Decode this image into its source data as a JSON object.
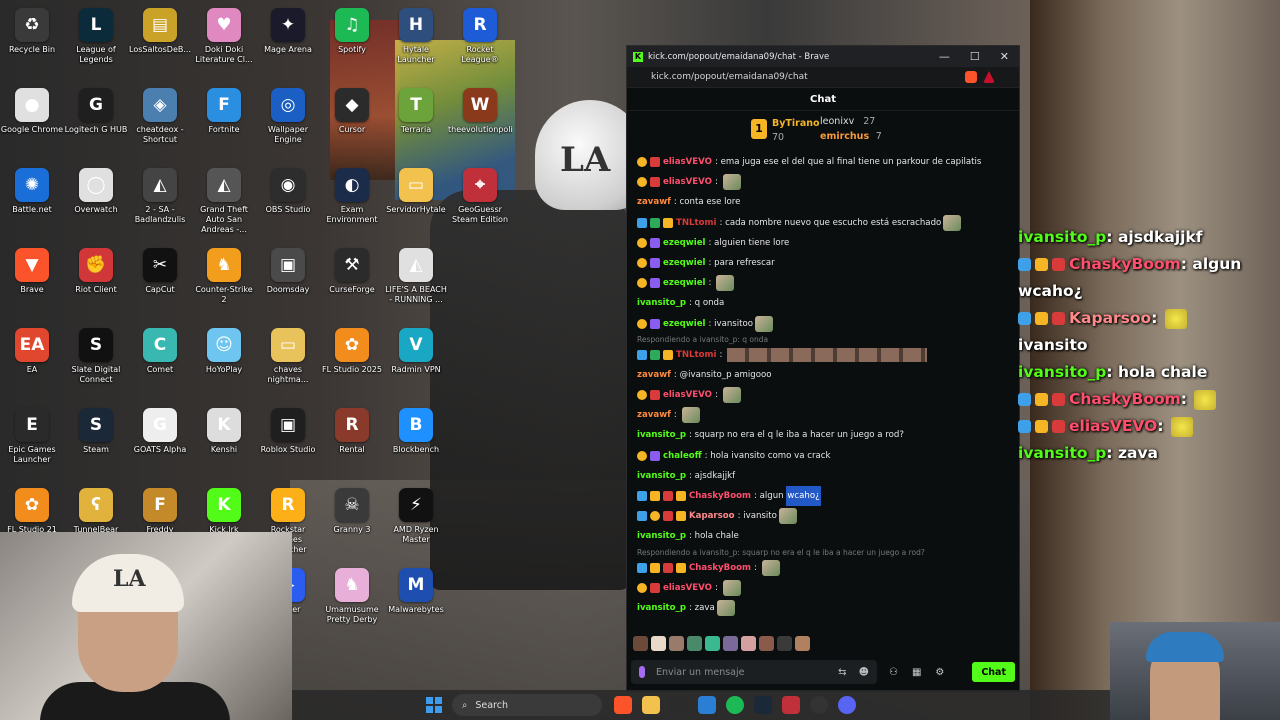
{
  "desktop_icons": [
    {
      "label": "Recycle Bin",
      "color": "#3a3a3a",
      "glyph": "♻"
    },
    {
      "label": "League of Legends",
      "color": "#0b2a3a",
      "glyph": "L"
    },
    {
      "label": "LosSaltosDeB...",
      "color": "#c9a227",
      "glyph": "▤"
    },
    {
      "label": "Doki Doki Literature Cl...",
      "color": "#e089c0",
      "glyph": "♥"
    },
    {
      "label": "Mage Arena",
      "color": "#1a1a2a",
      "glyph": "✦"
    },
    {
      "label": "Spotify",
      "color": "#1db954",
      "glyph": "♫"
    },
    {
      "label": "Hytale Launcher",
      "color": "#2e4e7e",
      "glyph": "H"
    },
    {
      "label": "Rocket League®",
      "color": "#1e5bd6",
      "glyph": "R"
    },
    {
      "label": "Google Chrome",
      "color": "#e0e0e0",
      "glyph": "●"
    },
    {
      "label": "Logitech G HUB",
      "color": "#1f1f1f",
      "glyph": "G"
    },
    {
      "label": "cheatdeox - Shortcut",
      "color": "#4a7fb0",
      "glyph": "◈"
    },
    {
      "label": "Fortnite",
      "color": "#2a8fe0",
      "glyph": "F"
    },
    {
      "label": "Wallpaper Engine",
      "color": "#1b5ec4",
      "glyph": "◎"
    },
    {
      "label": "Cursor",
      "color": "#2b2b2b",
      "glyph": "◆"
    },
    {
      "label": "Terraria",
      "color": "#6ca33a",
      "glyph": "T"
    },
    {
      "label": "theevolutionpoli...",
      "color": "#8a3a1a",
      "glyph": "W"
    },
    {
      "label": "Battle.net",
      "color": "#1a6ed8",
      "glyph": "✺"
    },
    {
      "label": "Overwatch",
      "color": "#e0e0e0",
      "glyph": "◯"
    },
    {
      "label": "2 - SA - Badlandzulis",
      "color": "#444",
      "glyph": "◭"
    },
    {
      "label": "Grand Theft Auto San Andreas -...",
      "color": "#555",
      "glyph": "◭"
    },
    {
      "label": "OBS Studio",
      "color": "#2d2d2d",
      "glyph": "◉"
    },
    {
      "label": "Exam Environment",
      "color": "#1b2b4a",
      "glyph": "◐"
    },
    {
      "label": "ServidorHytale",
      "color": "#f2c14e",
      "glyph": "▭"
    },
    {
      "label": "GeoGuessr Steam Edition",
      "color": "#c0303a",
      "glyph": "⌖"
    },
    {
      "label": "Brave",
      "color": "#fb542b",
      "glyph": "▼"
    },
    {
      "label": "Riot Client",
      "color": "#d13639",
      "glyph": "✊"
    },
    {
      "label": "CapCut",
      "color": "#111",
      "glyph": "✂"
    },
    {
      "label": "Counter-Strike 2",
      "color": "#f29d1c",
      "glyph": "♞"
    },
    {
      "label": "Doomsday",
      "color": "#4a4a4a",
      "glyph": "▣"
    },
    {
      "label": "CurseForge",
      "color": "#2b2b2b",
      "glyph": "⚒"
    },
    {
      "label": "LIFE'S A BEACH - RUNNING ...",
      "color": "#e0e0e0",
      "glyph": "◭"
    },
    {
      "label": "EA",
      "color": "#e0472e",
      "glyph": "EA"
    },
    {
      "label": "Slate Digital Connect",
      "color": "#111",
      "glyph": "S"
    },
    {
      "label": "Comet",
      "color": "#38b8b0",
      "glyph": "C"
    },
    {
      "label": "HoYoPlay",
      "color": "#6ec6f0",
      "glyph": "☺"
    },
    {
      "label": "chaves nightma...",
      "color": "#e8c25a",
      "glyph": "▭"
    },
    {
      "label": "FL Studio 2025",
      "color": "#f28c1c",
      "glyph": "✿"
    },
    {
      "label": "Radmin VPN",
      "color": "#1aa7c4",
      "glyph": "V"
    },
    {
      "label": "Epic Games Launcher",
      "color": "#2a2a2a",
      "glyph": "E"
    },
    {
      "label": "Steam",
      "color": "#1b2838",
      "glyph": "S"
    },
    {
      "label": "GOATS Alpha",
      "color": "#eee",
      "glyph": "G"
    },
    {
      "label": "Kenshi",
      "color": "#ddd",
      "glyph": "K"
    },
    {
      "label": "Roblox Studio",
      "color": "#1f1f1f",
      "glyph": "▣"
    },
    {
      "label": "Rental",
      "color": "#8a3a2a",
      "glyph": "R"
    },
    {
      "label": "Blockbench",
      "color": "#1e90ff",
      "glyph": "B"
    },
    {
      "label": "FL Studio 21",
      "color": "#f28c1c",
      "glyph": "✿"
    },
    {
      "label": "TunnelBear",
      "color": "#e2b33c",
      "glyph": "ʕ"
    },
    {
      "label": "Freddy Fazbear's",
      "color": "#c48a2a",
      "glyph": "F"
    },
    {
      "label": "Kick.lrk",
      "color": "#53fc18",
      "glyph": "K"
    },
    {
      "label": "Rockstar Games Launcher",
      "color": "#fcaf17",
      "glyph": "R"
    },
    {
      "label": "Granny 3",
      "color": "#3a3a3a",
      "glyph": "☠"
    },
    {
      "label": "AMD Ryzen Master",
      "color": "#111",
      "glyph": "⚡"
    },
    {
      "label": "Player",
      "color": "#2a5cf0",
      "glyph": "▶"
    },
    {
      "label": "Umamusume Pretty Derby",
      "color": "#e8b0d8",
      "glyph": "♞"
    },
    {
      "label": "Malwarebytes",
      "color": "#1d4eb0",
      "glyph": "M"
    }
  ],
  "browser": {
    "window_title": "kick.com/popout/emaidana09/chat - Brave",
    "url": "kick.com/popout/emaidana09/chat",
    "min": "—",
    "max": "☐",
    "close": "✕",
    "favicon": "K"
  },
  "chat": {
    "header": "Chat",
    "top_gifters": {
      "first_name": "ByTirano",
      "first_count": "70",
      "second_name": "leonixv",
      "second_count": "27",
      "third_name": "emirchus",
      "third_count": "7",
      "rank_glyph": "1"
    },
    "messages": [
      {
        "user": "eliasVEVO",
        "color": "#ff4f6d",
        "badges": [
          "sub",
          "red"
        ],
        "text": "ema juga ese el del que al final tiene un parkour de capilatis"
      },
      {
        "user": "eliasVEVO",
        "color": "#ff4f6d",
        "badges": [
          "sub",
          "red"
        ],
        "text": "",
        "emote": true
      },
      {
        "user": "zavawf",
        "color": "#ff8a3d",
        "badges": [],
        "text": "conta ese lore"
      },
      {
        "user": "TNLtomi",
        "color": "#d93a3a",
        "badges": [
          "mod",
          "green",
          "og"
        ],
        "text": "cada nombre nuevo que escucho está escrachado",
        "emote": true
      },
      {
        "user": "ezeqwiel",
        "color": "#53fc18",
        "badges": [
          "sub",
          "purple"
        ],
        "text": "alguien tiene lore"
      },
      {
        "user": "ezeqwiel",
        "color": "#53fc18",
        "badges": [
          "sub",
          "purple"
        ],
        "text": "para refrescar"
      },
      {
        "user": "ezeqwiel",
        "color": "#53fc18",
        "badges": [
          "sub",
          "purple"
        ],
        "text": "",
        "emote": true
      },
      {
        "user": "ivansito_p",
        "color": "#53fc18",
        "badges": [],
        "text": "q onda"
      },
      {
        "user": "ezeqwiel",
        "color": "#53fc18",
        "badges": [
          "sub",
          "purple"
        ],
        "text": "ivansitoo",
        "emote": true
      },
      {
        "reply": "Respondiendo a ivansito_p: q onda"
      },
      {
        "user": "TNLtomi",
        "color": "#d93a3a",
        "badges": [
          "mod",
          "green",
          "og"
        ],
        "text": "",
        "strip": true
      },
      {
        "user": "zavawf",
        "color": "#ff8a3d",
        "badges": [],
        "text": "@ivansito_p amigooo"
      },
      {
        "user": "eliasVEVO",
        "color": "#ff4f6d",
        "badges": [
          "sub",
          "red"
        ],
        "text": "",
        "emote": true
      },
      {
        "user": "zavawf",
        "color": "#ff8a3d",
        "badges": [],
        "text": "",
        "emote": true
      },
      {
        "user": "ivansito_p",
        "color": "#53fc18",
        "badges": [],
        "text": "squarp no era el q le iba a hacer un juego a rod?"
      },
      {
        "user": "chaleoff",
        "color": "#53fc18",
        "badges": [
          "sub",
          "purple"
        ],
        "text": "hola ivansito como va crack"
      },
      {
        "user": "ivansito_p",
        "color": "#53fc18",
        "badges": [],
        "text": "ajsdkajjkf"
      },
      {
        "user": "ChaskyBoom",
        "color": "#ff4f6d",
        "badges": [
          "mod",
          "og",
          "red",
          "og"
        ],
        "text": "algun",
        "hl": "wcaho¿"
      },
      {
        "user": "Kaparsoo",
        "color": "#ff8a8a",
        "badges": [
          "mod",
          "sub",
          "red",
          "og"
        ],
        "text": "ivansito",
        "emote": true
      },
      {
        "user": "ivansito_p",
        "color": "#53fc18",
        "badges": [],
        "text": "hola chale"
      },
      {
        "reply": "Respondiendo a ivansito_p: squarp no era el q le iba a hacer un juego a rod?"
      },
      {
        "user": "ChaskyBoom",
        "color": "#ff4f6d",
        "badges": [
          "mod",
          "og",
          "red",
          "og"
        ],
        "text": "",
        "emote": true
      },
      {
        "user": "eliasVEVO",
        "color": "#ff4f6d",
        "badges": [
          "sub",
          "red"
        ],
        "text": "",
        "emote": true
      },
      {
        "user": "ivansito_p",
        "color": "#53fc18",
        "badges": [],
        "text": "zava",
        "emote": true
      }
    ],
    "input_placeholder": "Enviar un mensaje",
    "send_label": "Chat"
  },
  "overlay": [
    {
      "user": "ivansito_p",
      "color": "#53fc18",
      "text": "ajsdkajjkf"
    },
    {
      "user": "ChaskyBoom",
      "color": "#ff4f6d",
      "text": "algun"
    },
    {
      "cont": "wcaho¿"
    },
    {
      "user": "Kaparsoo",
      "color": "#ff8a8a",
      "text": ""
    },
    {
      "cont": "ivansito"
    },
    {
      "user": "ivansito_p",
      "color": "#53fc18",
      "text": "hola chale"
    },
    {
      "user": "ChaskyBoom",
      "color": "#ff4f6d",
      "text": ""
    },
    {
      "user": "eliasVEVO",
      "color": "#ff4f6d",
      "text": ""
    },
    {
      "user": "ivansito_p",
      "color": "#53fc18",
      "text": "zava"
    }
  ],
  "taskbar": {
    "search_label": "Search"
  },
  "colors": {
    "kick_green": "#53fc18",
    "sub_gold": "#f5b524"
  }
}
